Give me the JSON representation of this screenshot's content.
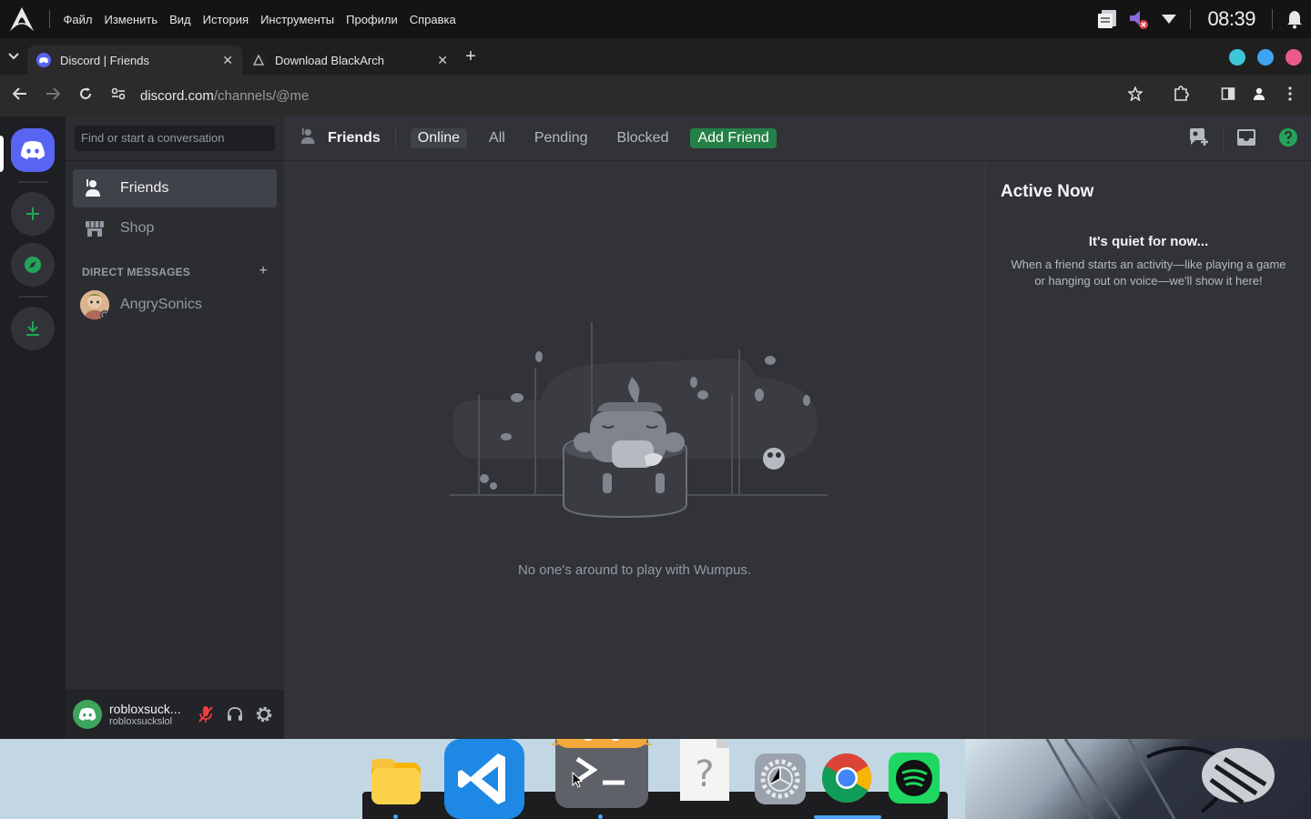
{
  "system_bar": {
    "menu": [
      "Файл",
      "Изменить",
      "Вид",
      "История",
      "Инструменты",
      "Профили",
      "Справка"
    ],
    "clock": "08:39"
  },
  "browser": {
    "tabs": [
      {
        "title": "Discord | Friends",
        "active": true
      },
      {
        "title": "Download BlackArch",
        "active": false
      }
    ],
    "url_host": "discord.com",
    "url_path": "/channels/@me",
    "window_dot_colors": [
      "#3ec7d8",
      "#3fa4f0",
      "#ea5a8c"
    ]
  },
  "sidebar": {
    "search_placeholder": "Find or start a conversation",
    "nav": [
      {
        "label": "Friends",
        "icon": "friends-icon",
        "active": true
      },
      {
        "label": "Shop",
        "icon": "shop-icon",
        "active": false
      }
    ],
    "dm_header": "DIRECT MESSAGES",
    "dms": [
      {
        "name": "AngrySonics"
      }
    ]
  },
  "user_panel": {
    "display_name": "robloxsuck...",
    "username": "robloxsuckslol"
  },
  "friends_bar": {
    "title": "Friends",
    "tabs": [
      "Online",
      "All",
      "Pending",
      "Blocked"
    ],
    "selected_tab": "Online",
    "add_friend": "Add Friend"
  },
  "empty_state": {
    "message": "No one's around to play with Wumpus."
  },
  "active_now": {
    "heading": "Active Now",
    "subheading": "It's quiet for now...",
    "body": "When a friend starts an activity—like playing a game or hanging out on voice—we'll show it here!"
  },
  "colors": {
    "blurple": "#5865f2",
    "green": "#248046",
    "status_green": "#3ba55c"
  }
}
